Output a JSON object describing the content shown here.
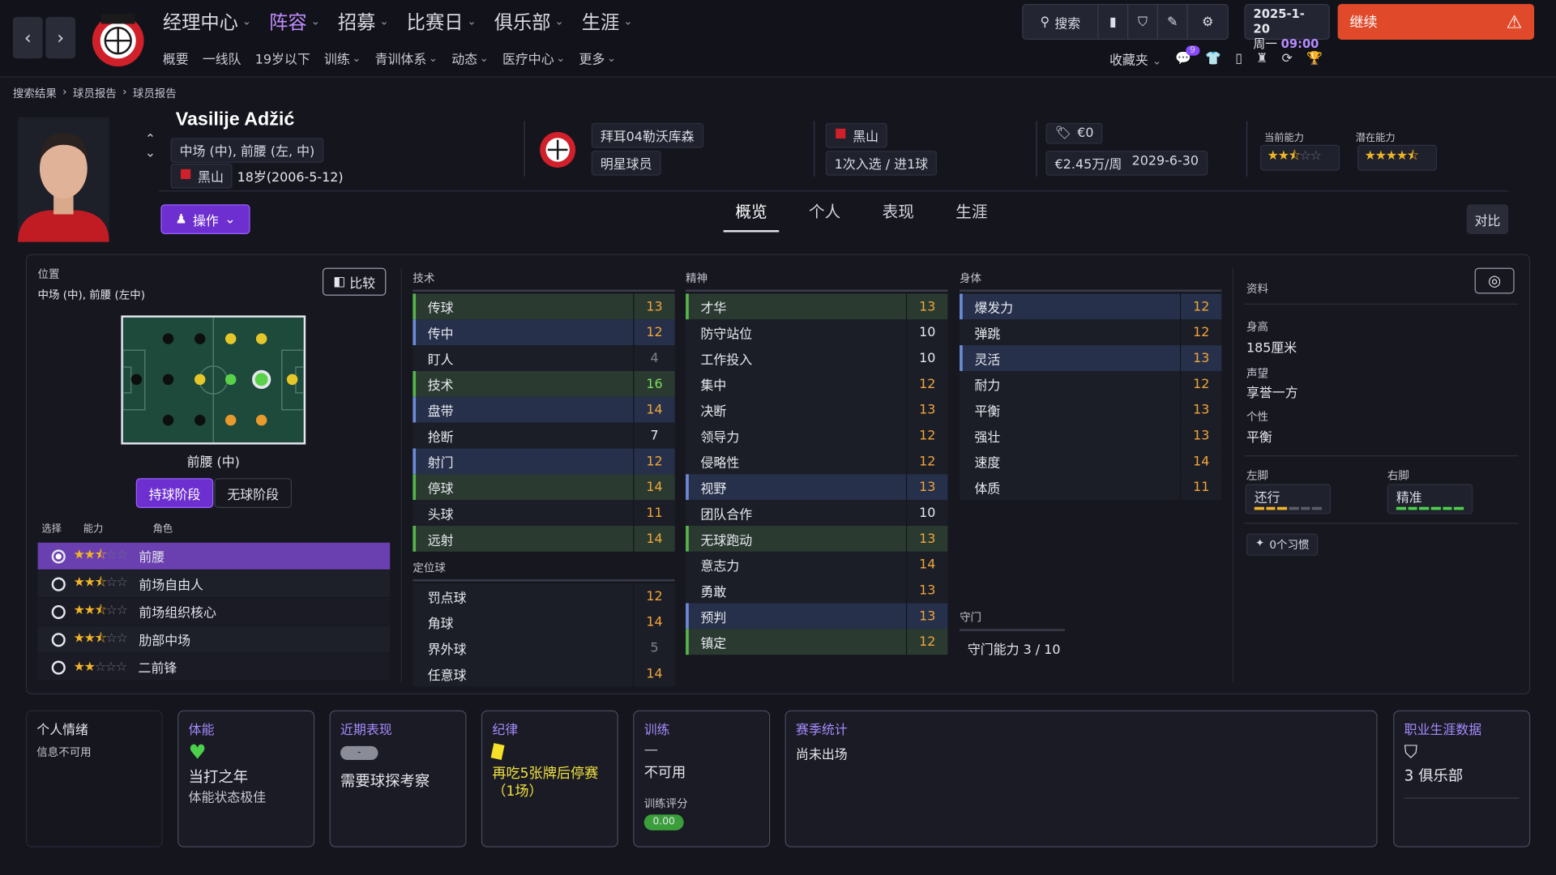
{
  "nav": {
    "main": [
      "经理中心",
      "阵容",
      "招募",
      "比赛日",
      "俱乐部",
      "生涯"
    ],
    "sub": [
      "概要",
      "一线队",
      "19岁以下",
      "训练",
      "青训体系",
      "动态",
      "医疗中心",
      "更多"
    ],
    "search": "搜索",
    "date": "2025-1-20",
    "weekday": "周一",
    "time": "09:00",
    "continue": "继续",
    "favorites": "收藏夹",
    "badge_count": "9"
  },
  "breadcrumb": [
    "搜索结果",
    "球员报告",
    "球员报告"
  ],
  "player": {
    "name": "Vasilije Adžić",
    "positions": "中场 (中), 前腰 (左, 中)",
    "nation": "黑山",
    "age": "18岁(2006-5-12)",
    "club": "拜耳04勒沃库森",
    "status": "明星球员",
    "intl_nation": "黑山",
    "caps": "1次入选 / 进1球",
    "value": "€0",
    "wage": "€2.45万/周",
    "contract_end": "2029-6-30",
    "ca_label": "当前能力",
    "pa_label": "潜在能力",
    "ca_stars": 2.5,
    "pa_stars": 4.5,
    "action": "操作"
  },
  "tabs": [
    "概览",
    "个人",
    "表现",
    "生涯"
  ],
  "compare_btn": "对比",
  "position_panel": {
    "title": "位置",
    "text": "中场 (中), 前腰 (左中)",
    "compare": "比较",
    "role_label": "前腰 (中)",
    "phase_in": "持球阶段",
    "phase_out": "无球阶段",
    "headers": [
      "选择",
      "能力",
      "角色"
    ],
    "roles": [
      {
        "name": "前腰",
        "stars": 2.5,
        "selected": true
      },
      {
        "name": "前场自由人",
        "stars": 2.5,
        "selected": false
      },
      {
        "name": "前场组织核心",
        "stars": 2.5,
        "selected": false
      },
      {
        "name": "肋部中场",
        "stars": 2.5,
        "selected": false
      },
      {
        "name": "二前锋",
        "stars": 2,
        "selected": false
      }
    ]
  },
  "technical": {
    "title": "技术",
    "rows": [
      {
        "n": "传球",
        "v": "13",
        "h": "g"
      },
      {
        "n": "传中",
        "v": "12",
        "h": "b"
      },
      {
        "n": "盯人",
        "v": "4",
        "h": ""
      },
      {
        "n": "技术",
        "v": "16",
        "h": "g"
      },
      {
        "n": "盘带",
        "v": "14",
        "h": "b"
      },
      {
        "n": "抢断",
        "v": "7",
        "h": ""
      },
      {
        "n": "射门",
        "v": "12",
        "h": "b"
      },
      {
        "n": "停球",
        "v": "14",
        "h": "g"
      },
      {
        "n": "头球",
        "v": "11",
        "h": ""
      },
      {
        "n": "远射",
        "v": "14",
        "h": "g"
      }
    ]
  },
  "setpieces": {
    "title": "定位球",
    "rows": [
      {
        "n": "罚点球",
        "v": "12",
        "h": ""
      },
      {
        "n": "角球",
        "v": "14",
        "h": ""
      },
      {
        "n": "界外球",
        "v": "5",
        "h": ""
      },
      {
        "n": "任意球",
        "v": "14",
        "h": ""
      }
    ]
  },
  "mental": {
    "title": "精神",
    "rows": [
      {
        "n": "才华",
        "v": "13",
        "h": "g"
      },
      {
        "n": "防守站位",
        "v": "10",
        "h": ""
      },
      {
        "n": "工作投入",
        "v": "10",
        "h": ""
      },
      {
        "n": "集中",
        "v": "12",
        "h": ""
      },
      {
        "n": "决断",
        "v": "13",
        "h": ""
      },
      {
        "n": "领导力",
        "v": "12",
        "h": ""
      },
      {
        "n": "侵略性",
        "v": "12",
        "h": ""
      },
      {
        "n": "视野",
        "v": "13",
        "h": "b"
      },
      {
        "n": "团队合作",
        "v": "10",
        "h": ""
      },
      {
        "n": "无球跑动",
        "v": "13",
        "h": "g"
      },
      {
        "n": "意志力",
        "v": "14",
        "h": ""
      },
      {
        "n": "勇敢",
        "v": "13",
        "h": ""
      },
      {
        "n": "预判",
        "v": "13",
        "h": "b"
      },
      {
        "n": "镇定",
        "v": "12",
        "h": "g"
      }
    ]
  },
  "physical": {
    "title": "身体",
    "rows": [
      {
        "n": "爆发力",
        "v": "12",
        "h": "b"
      },
      {
        "n": "弹跳",
        "v": "12",
        "h": ""
      },
      {
        "n": "灵活",
        "v": "13",
        "h": "b"
      },
      {
        "n": "耐力",
        "v": "12",
        "h": ""
      },
      {
        "n": "平衡",
        "v": "13",
        "h": ""
      },
      {
        "n": "强壮",
        "v": "13",
        "h": ""
      },
      {
        "n": "速度",
        "v": "14",
        "h": ""
      },
      {
        "n": "体质",
        "v": "11",
        "h": ""
      }
    ]
  },
  "goalkeeping": {
    "title": "守门",
    "text": "守门能力 3 / 10"
  },
  "info": {
    "title": "资料",
    "height_label": "身高",
    "height": "185厘米",
    "rep_label": "声望",
    "rep": "享誉一方",
    "pers_label": "个性",
    "pers": "平衡",
    "lf_label": "左脚",
    "lf": "还行",
    "rf_label": "右脚",
    "rf": "精准",
    "habits": "0个习惯"
  },
  "cards": {
    "mood": {
      "title": "个人情绪",
      "text": "信息不可用"
    },
    "fitness": {
      "title": "体能",
      "line1": "当打之年",
      "line2": "体能状态极佳"
    },
    "form": {
      "title": "近期表现",
      "pill": "-",
      "text": "需要球探考察"
    },
    "discipline": {
      "title": "纪律",
      "text": "再吃5张牌后停赛（1场）"
    },
    "training": {
      "title": "训练",
      "dash": "—",
      "text": "不可用",
      "rating_label": "训练评分",
      "rating": "0.00"
    },
    "season": {
      "title": "赛季统计",
      "text": "尚未出场"
    },
    "career": {
      "title": "职业生涯数据",
      "text": "3 俱乐部"
    }
  },
  "colors": {
    "accent": "#a068ff",
    "continue": "#e0492a",
    "star": "#f0b429",
    "good": "#57b34c"
  }
}
